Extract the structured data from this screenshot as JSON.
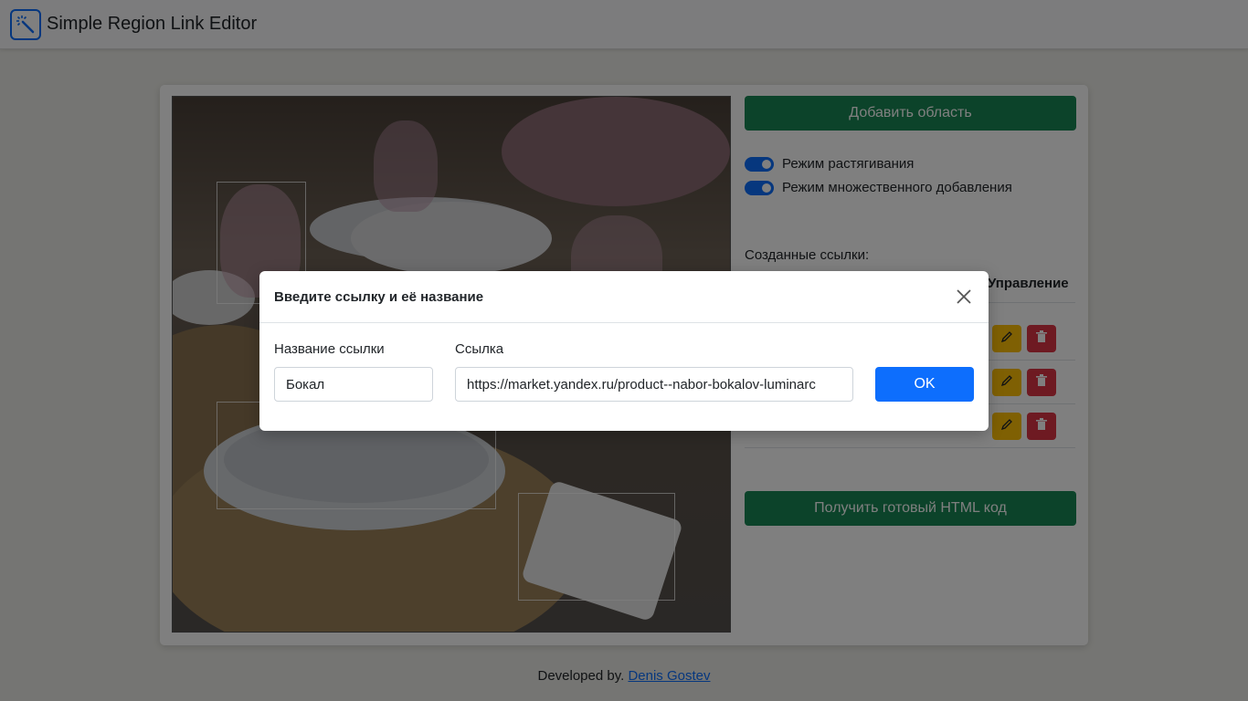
{
  "app": {
    "title": "Simple Region Link Editor"
  },
  "sidebar": {
    "add_region_label": "Добавить область",
    "stretch_mode_label": "Режим растягивания",
    "multi_add_mode_label": "Режим множественного добавления",
    "stretch_mode_on": true,
    "multi_add_mode_on": true,
    "created_links_label": "Созданные ссылки:",
    "table_header_manage": "Управление",
    "get_html_label": "Получить готовый HTML код"
  },
  "footer": {
    "prefix": "Developed by.",
    "author": "Denis Gostev"
  },
  "modal": {
    "title": "Введите ссылку и её название",
    "name_label": "Название ссылки",
    "name_value": "Бокал",
    "link_label": "Ссылка",
    "link_value": "https://market.yandex.ru/product--nabor-bokalov-luminarc",
    "ok_label": "OK"
  },
  "colors": {
    "primary": "#0d6efd",
    "success": "#198754",
    "warning": "#ffc107",
    "danger": "#dc3545"
  },
  "icons": {
    "logo": "magic-wand-icon",
    "edit": "pencil-icon",
    "delete": "trash-icon",
    "close": "close-icon"
  }
}
